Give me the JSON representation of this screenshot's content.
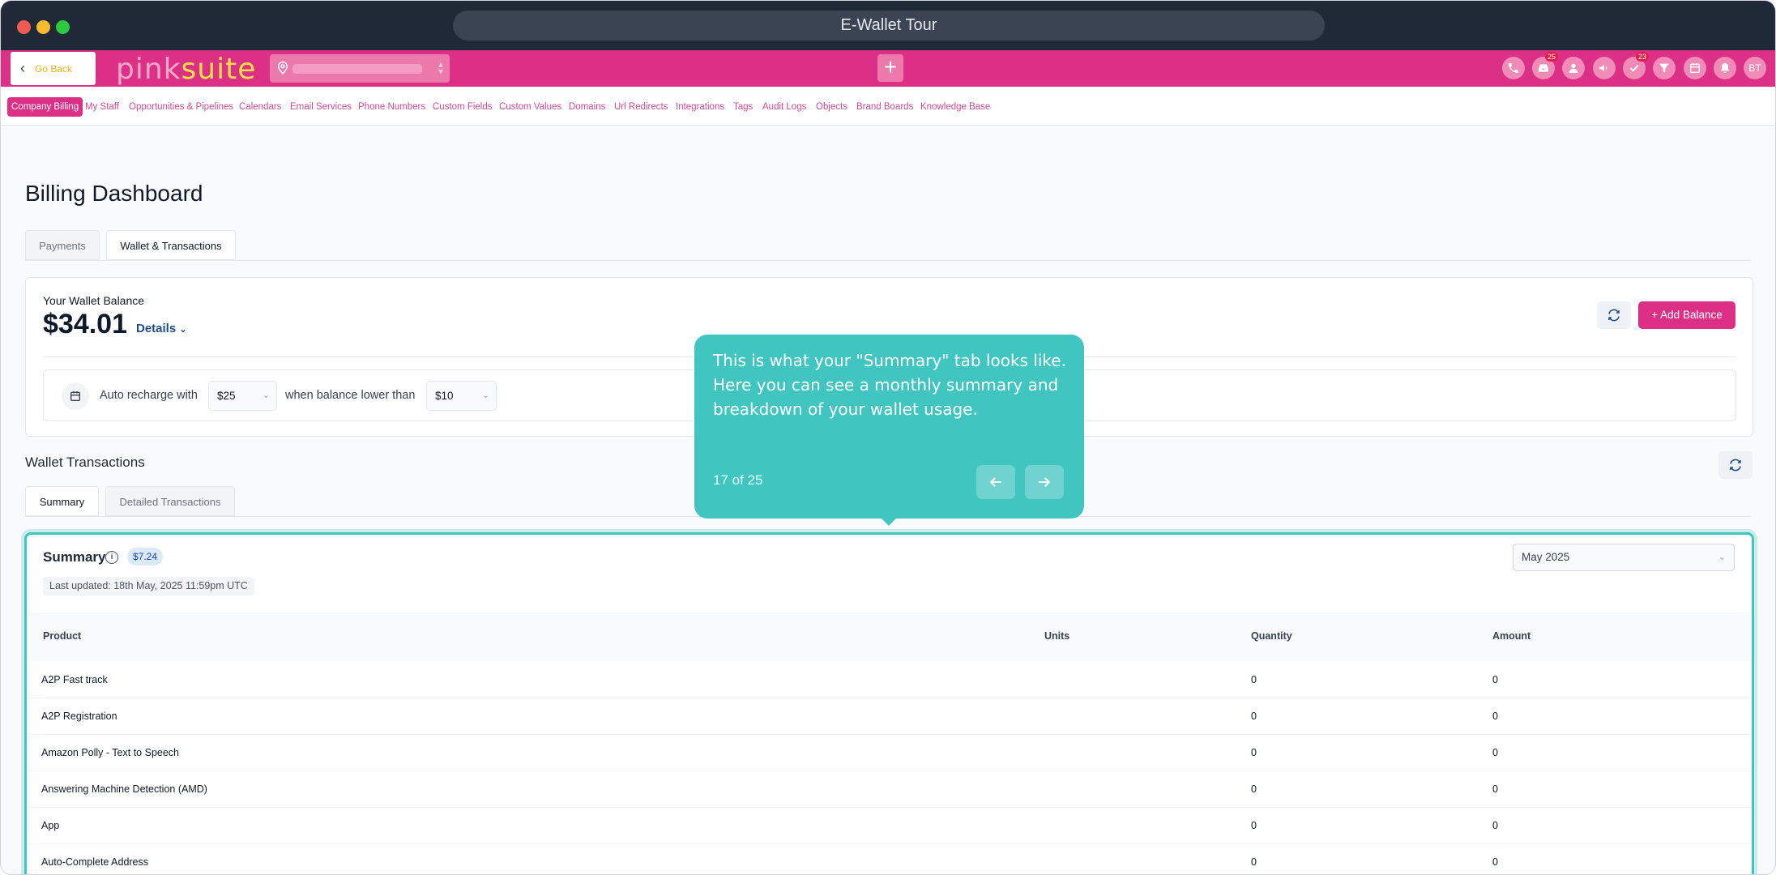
{
  "window": {
    "title": "E-Wallet Tour"
  },
  "header": {
    "go_back": "Go Back",
    "logo_a": "pink",
    "logo_b": "suite",
    "notification_badge_inbox": "25",
    "notification_badge_tasks": "23",
    "avatar_initials": "BT"
  },
  "nav": {
    "items": [
      "Company Billing",
      "My Staff",
      "Opportunities & Pipelines",
      "Calendars",
      "Email Services",
      "Phone Numbers",
      "Custom Fields",
      "Custom Values",
      "Domains",
      "Url Redirects",
      "Integrations",
      "Tags",
      "Audit Logs",
      "Objects",
      "Brand Boards",
      "Knowledge Base"
    ]
  },
  "page": {
    "title": "Billing Dashboard",
    "tabs": [
      "Payments",
      "Wallet & Transactions"
    ]
  },
  "wallet": {
    "label": "Your Wallet Balance",
    "balance": "$34.01",
    "details": "Details",
    "add_balance": "Add Balance",
    "auto_recharge_label": "Auto recharge with",
    "recharge_amount": "$25",
    "threshold_label": "when balance lower than",
    "threshold_amount": "$10"
  },
  "transactions": {
    "title": "Wallet Transactions",
    "tabs": [
      "Summary",
      "Detailed Transactions"
    ]
  },
  "summary": {
    "title": "Summary",
    "info": "i",
    "total": "$7.24",
    "last_updated": "Last updated: 18th May, 2025 11:59pm UTC",
    "month": "May 2025",
    "columns": [
      "Product",
      "Units",
      "Quantity",
      "Amount"
    ],
    "rows": [
      {
        "product": "A2P Fast track",
        "units": "",
        "quantity": "0",
        "amount": "0"
      },
      {
        "product": "A2P Registration",
        "units": "",
        "quantity": "0",
        "amount": "0"
      },
      {
        "product": "Amazon Polly - Text to Speech",
        "units": "",
        "quantity": "0",
        "amount": "0"
      },
      {
        "product": "Answering Machine Detection (AMD)",
        "units": "",
        "quantity": "0",
        "amount": "0"
      },
      {
        "product": "App",
        "units": "",
        "quantity": "0",
        "amount": "0"
      },
      {
        "product": "Auto-Complete Address",
        "units": "",
        "quantity": "0",
        "amount": "0"
      }
    ]
  },
  "tour": {
    "text": "This is what your \"Summary\" tab looks like. Here you can see a monthly summary and breakdown of your wallet usage.",
    "step": "17 of 25"
  },
  "colors": {
    "brand_pink": "#dc2f86",
    "tour_teal": "#40c5c0",
    "titlebar": "#1f2937"
  }
}
